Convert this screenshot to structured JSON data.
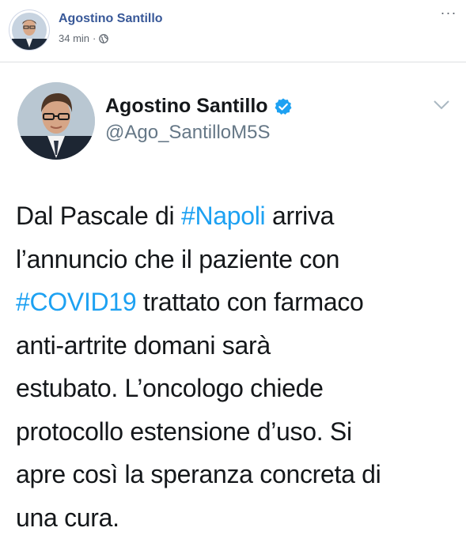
{
  "post": {
    "author_name": "Agostino Santillo",
    "time_ago": "34 min",
    "separator": "·",
    "privacy_icon": "globe-icon",
    "more_icon": "more-options-icon",
    "more_label": "···"
  },
  "tweet": {
    "display_name": "Agostino Santillo",
    "handle": "@Ago_SantilloM5S",
    "verified_icon": "verified-badge-icon",
    "menu_icon": "chevron-down-icon",
    "lines": [
      [
        {
          "t": "Dal Pascale di "
        },
        {
          "t": "#Napoli",
          "tag": true
        },
        {
          "t": "  arriva"
        }
      ],
      [
        {
          "t": "l’annuncio che il paziente con"
        }
      ],
      [
        {
          "t": "#COVID19",
          "tag": true
        },
        {
          "t": " trattato con farmaco"
        }
      ],
      [
        {
          "t": "anti-artrite domani sarà"
        }
      ],
      [
        {
          "t": "estubato. L’oncologo chiede"
        }
      ],
      [
        {
          "t": "protocollo estensione d’uso. Si"
        }
      ],
      [
        {
          "t": "apre così la speranza concreta di"
        }
      ],
      [
        {
          "t": "una cura."
        }
      ]
    ]
  },
  "colors": {
    "facebook_link": "#385898",
    "meta_gray": "#606770",
    "twitter_blue": "#1da1f2",
    "tweet_text": "#14171a",
    "handle_gray": "#657786"
  }
}
